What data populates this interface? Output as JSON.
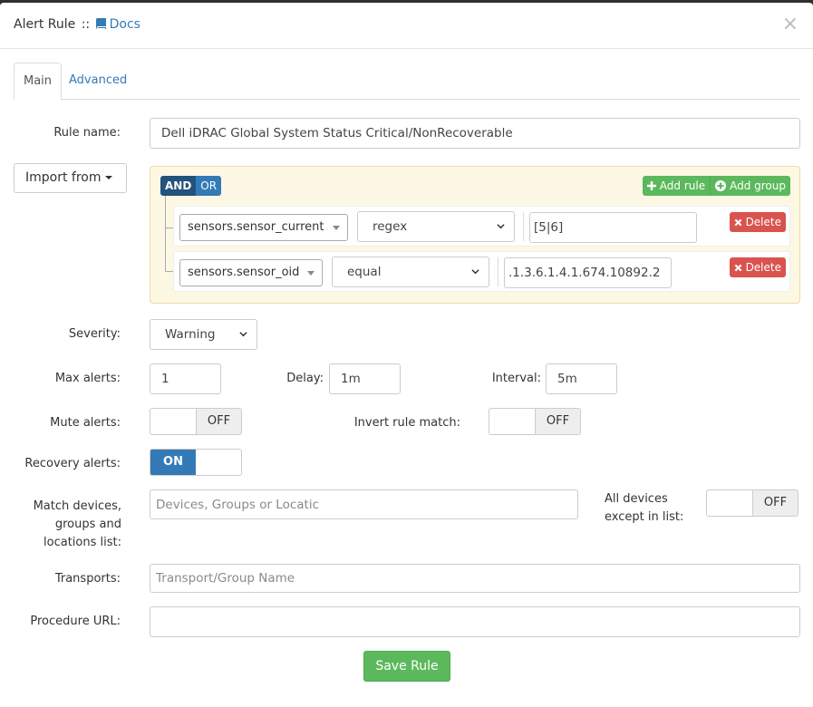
{
  "header": {
    "title": "Alert Rule",
    "separator": "::",
    "docs_label": "Docs",
    "close_label": "×"
  },
  "tabs": [
    {
      "label": "Main",
      "active": true
    },
    {
      "label": "Advanced",
      "active": false
    }
  ],
  "form": {
    "rule_name_label": "Rule name:",
    "rule_name_value": "Dell iDRAC Global System Status Critical/NonRecoverable",
    "import_label": "Import from",
    "severity_label": "Severity:",
    "severity_value": "Warning",
    "max_alerts_label": "Max alerts:",
    "max_alerts_value": "1",
    "delay_label": "Delay:",
    "delay_value": "1m",
    "interval_label": "Interval:",
    "interval_value": "5m",
    "mute_label": "Mute alerts:",
    "mute_state": "OFF",
    "invert_label": "Invert rule match:",
    "invert_state": "OFF",
    "recovery_label": "Recovery alerts:",
    "recovery_state": "ON",
    "match_label_1": "Match devices,",
    "match_label_2": "groups and",
    "match_label_3": "locations list:",
    "match_placeholder": "Devices, Groups or Locatic",
    "all_devices_label_1": "All devices",
    "all_devices_label_2": "except in list:",
    "all_devices_state": "OFF",
    "transports_label": "Transports:",
    "transports_placeholder": "Transport/Group Name",
    "procedure_label": "Procedure URL:",
    "procedure_value": "",
    "save_label": "Save Rule"
  },
  "builder": {
    "and_label": "AND",
    "or_label": "OR",
    "add_rule_label": "Add rule",
    "add_group_label": "Add group",
    "delete_label": "Delete",
    "rules": [
      {
        "field": "sensors.sensor_current",
        "operator": "regex",
        "value": "[5|6]"
      },
      {
        "field": "sensors.sensor_oid",
        "operator": "equal",
        "value": ".1.3.6.1.4.1.674.10892.2"
      }
    ]
  },
  "colors": {
    "primary": "#337ab7",
    "success": "#5cb85c",
    "danger": "#d9534f",
    "builder_bg": "#fcf8e3"
  },
  "icons": [
    "book-icon",
    "close-icon",
    "plus-icon",
    "plus-circle-icon",
    "remove-icon",
    "chevron-down-icon",
    "caret-down-icon"
  ]
}
